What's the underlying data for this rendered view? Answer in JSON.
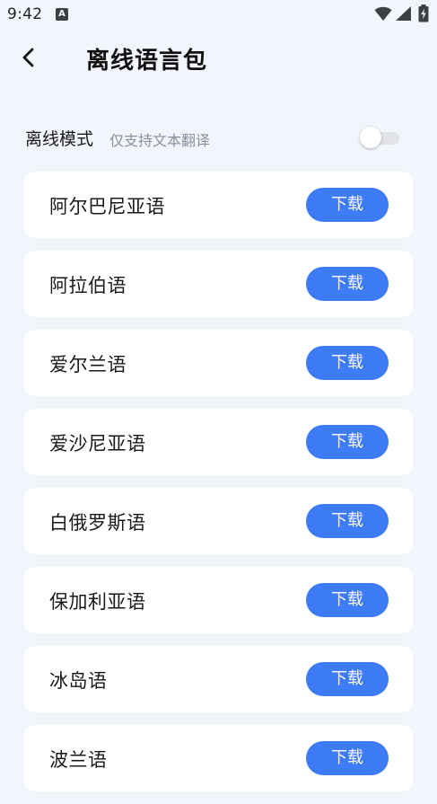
{
  "status_bar": {
    "time": "9:42",
    "icons": [
      "text-a-icon",
      "wifi-icon",
      "signal-icon",
      "battery-charging-icon"
    ]
  },
  "header": {
    "back_icon": "chevron-left-icon",
    "title": "离线语言包"
  },
  "offline_mode": {
    "label": "离线模式",
    "hint": "仅支持文本翻译",
    "enabled": false
  },
  "languages": [
    {
      "name": "阿尔巴尼亚语",
      "action": "下载"
    },
    {
      "name": "阿拉伯语",
      "action": "下载"
    },
    {
      "name": "爱尔兰语",
      "action": "下载"
    },
    {
      "name": "爱沙尼亚语",
      "action": "下载"
    },
    {
      "name": "白俄罗斯语",
      "action": "下载"
    },
    {
      "name": "保加利亚语",
      "action": "下载"
    },
    {
      "name": "冰岛语",
      "action": "下载"
    },
    {
      "name": "波兰语",
      "action": "下载"
    }
  ],
  "colors": {
    "background": "#f2f5fc",
    "card": "#ffffff",
    "accent": "#3e7cf7",
    "hint_text": "#8d9096"
  }
}
